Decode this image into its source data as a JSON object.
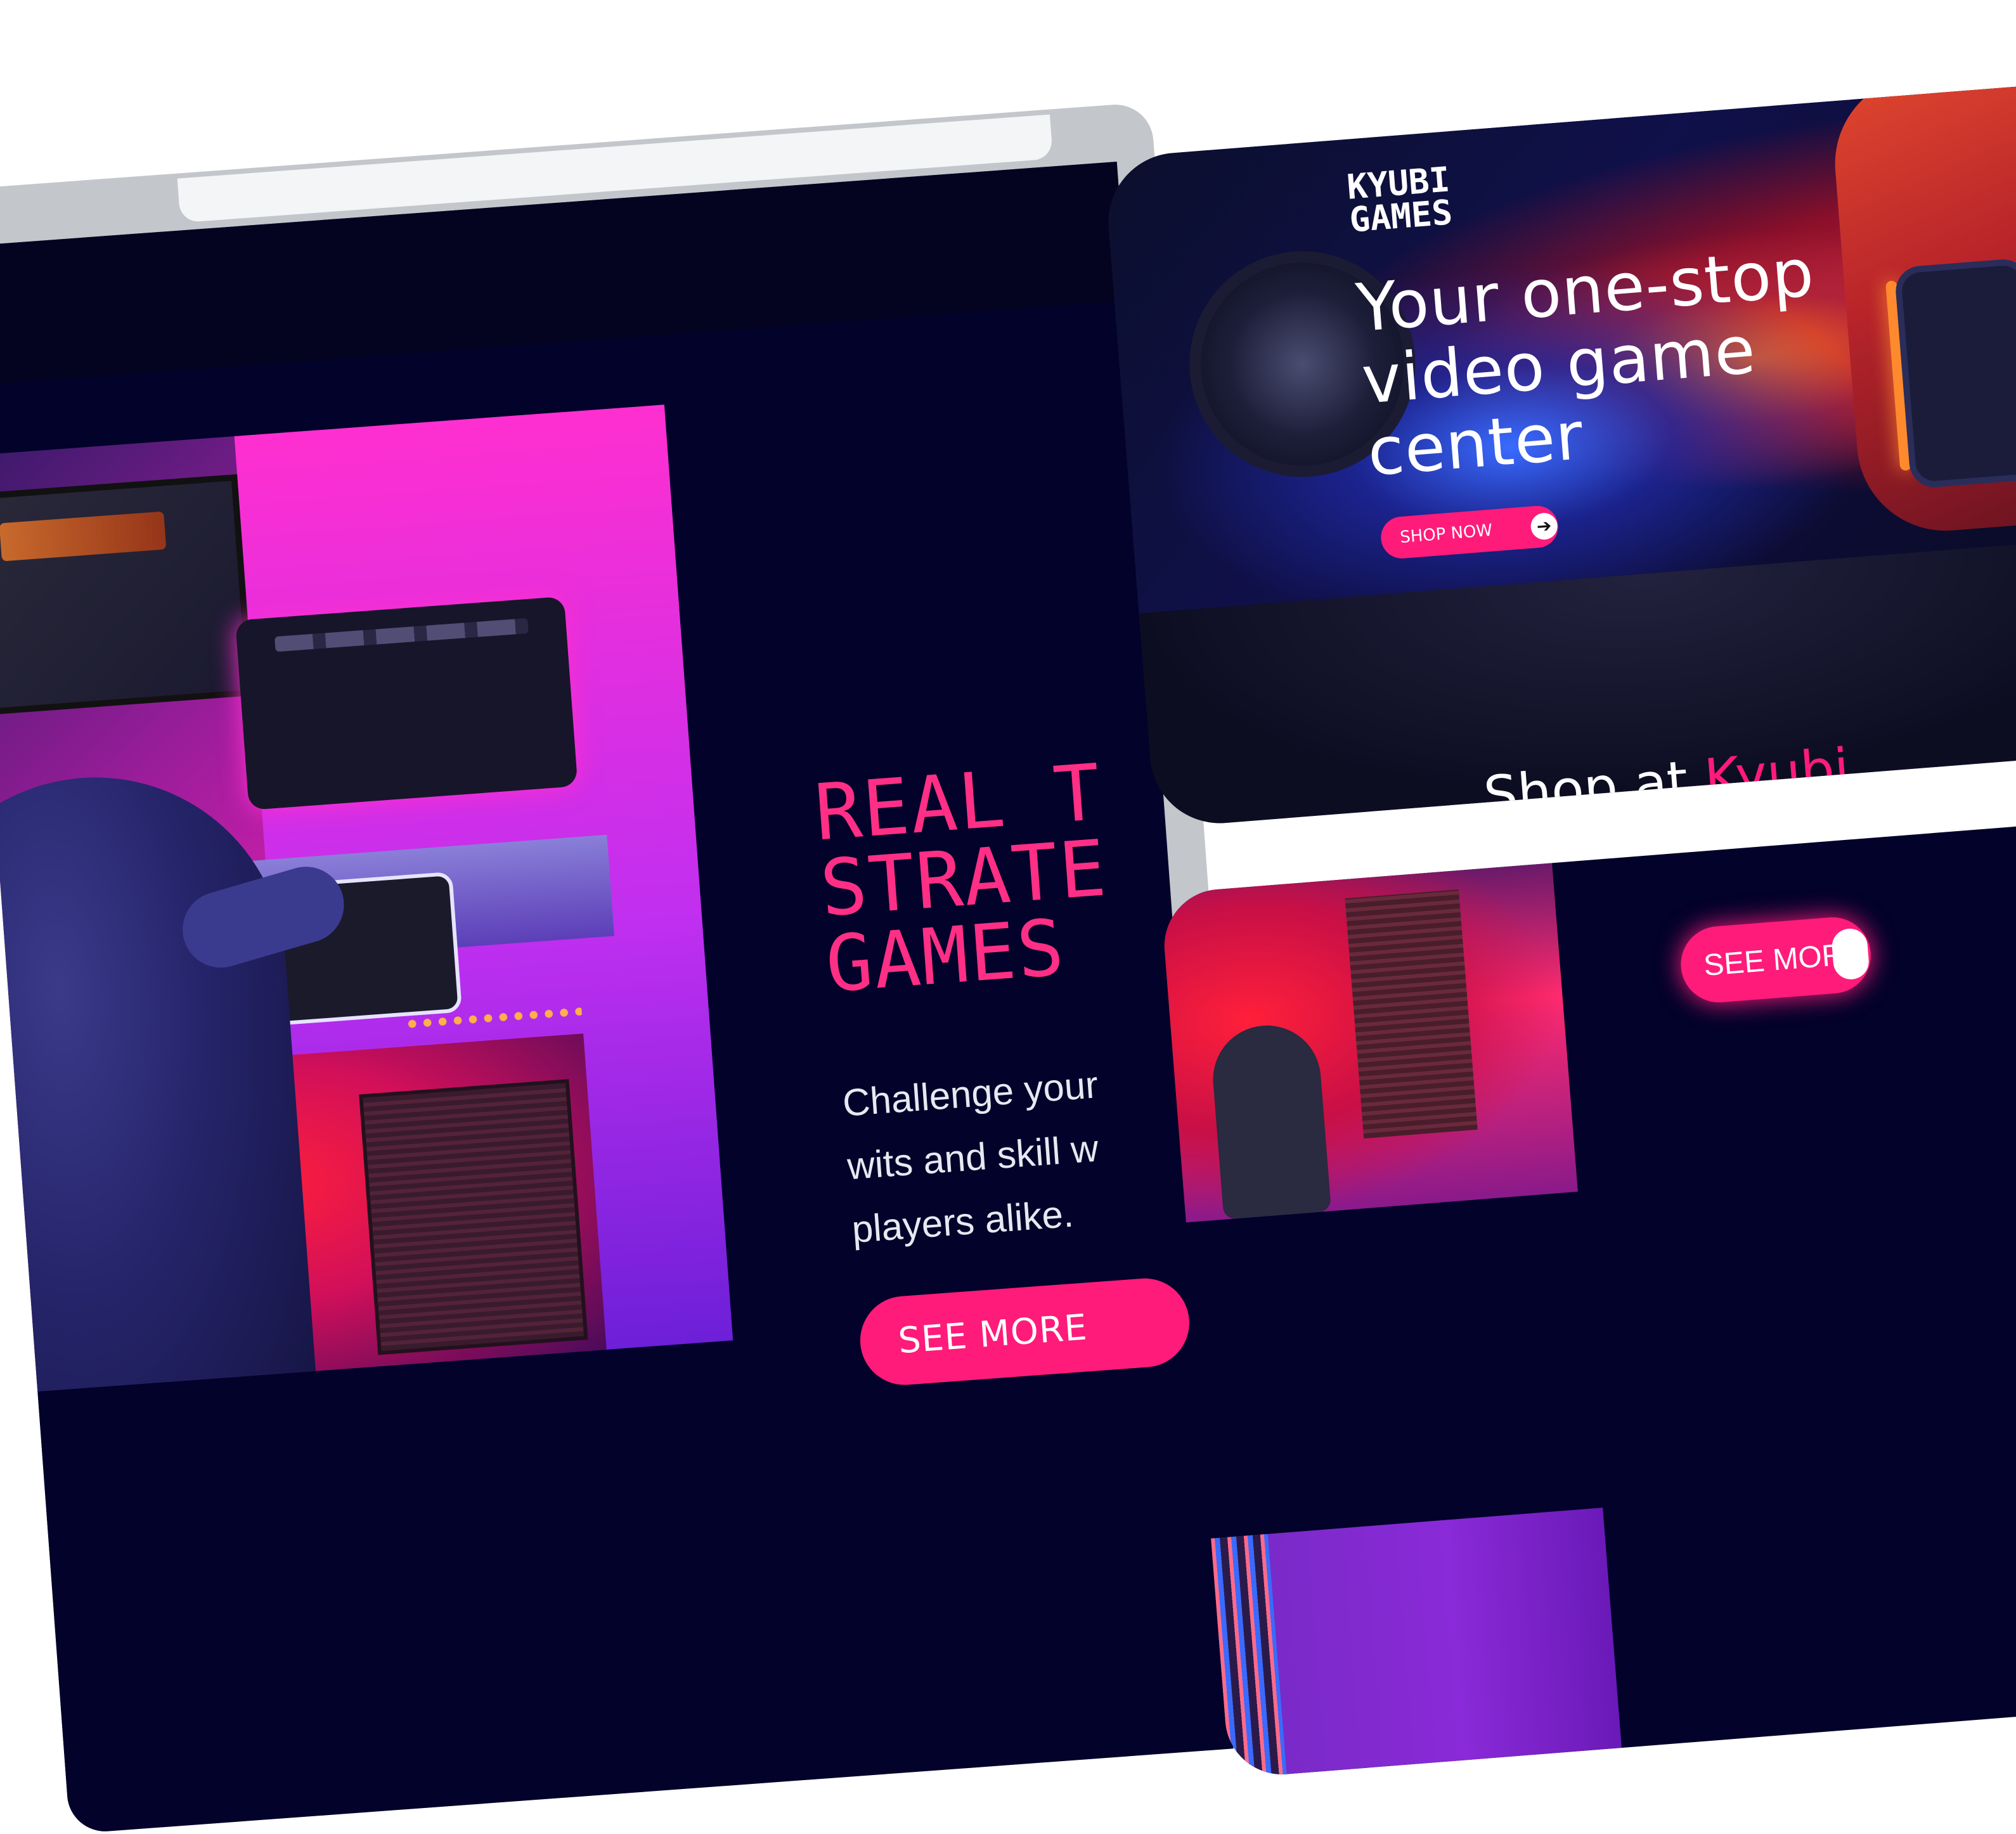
{
  "desktop": {
    "heading": "REAL T\nSTRATE\nGAMES",
    "description": "Challenge your\nwits and skill w\nplayers alike.",
    "see_more": "SEE MORE"
  },
  "mobile_hero": {
    "logo": "KYUBI\nGAMES",
    "title": "Your one-stop\nvideo game\ncenter",
    "shop_now": "SHOP NOW",
    "arrow_icon": "arrow-right-icon",
    "shop_heading_prefix": "Shop at ",
    "shop_heading_accent": "Kyubi"
  },
  "mobile_bottom": {
    "see_more": "SEE MORE"
  },
  "colors": {
    "accent": "#ff1b7a",
    "background": "#02022a",
    "heading_pink": "#ff2f86"
  }
}
